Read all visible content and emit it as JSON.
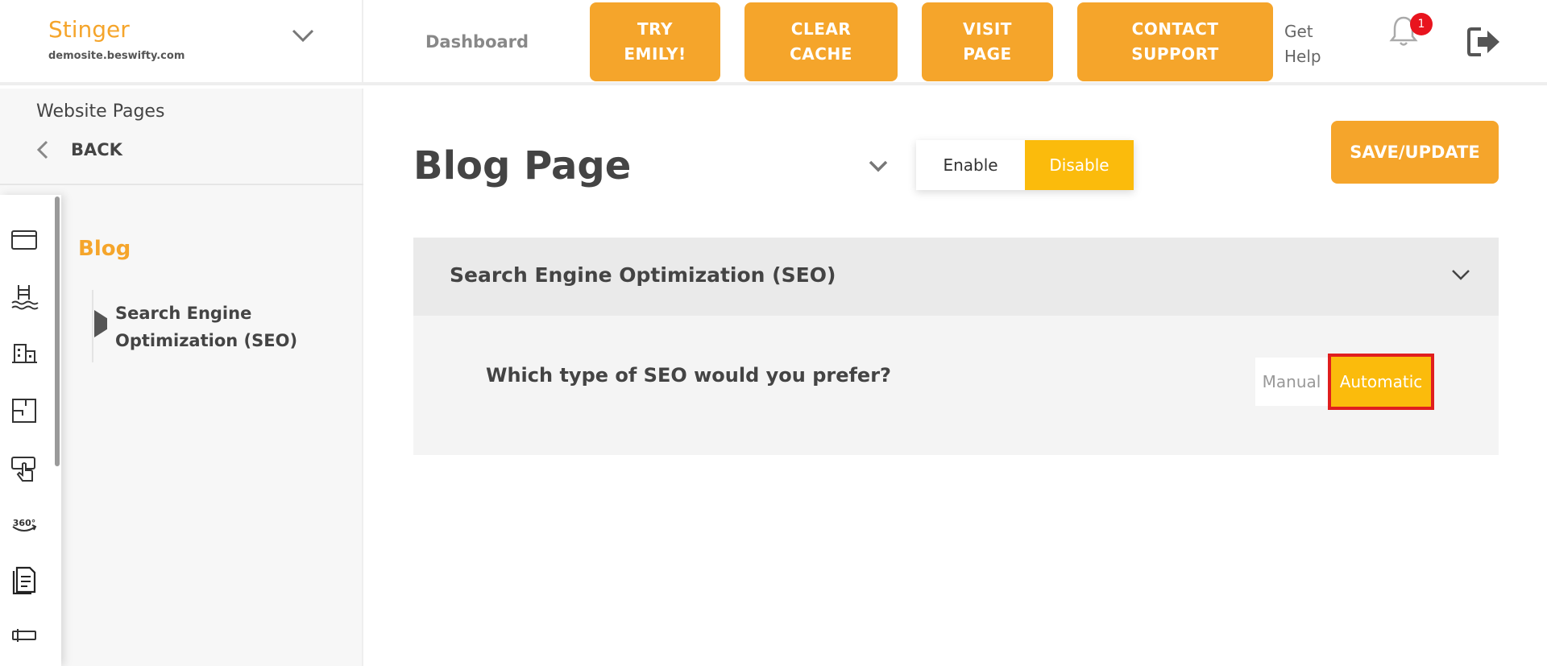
{
  "brand": {
    "name": "Stinger",
    "domain": "demosite.beswifty.com"
  },
  "header": {
    "dashboard": "Dashboard",
    "buttons": [
      {
        "line1": "TRY",
        "line2": "EMILY!"
      },
      {
        "line1": "CLEAR",
        "line2": "CACHE"
      },
      {
        "line1": "VISIT",
        "line2": "PAGE"
      },
      {
        "line1": "CONTACT",
        "line2": "SUPPORT"
      }
    ],
    "help": {
      "line1": "Get",
      "line2": "Help"
    },
    "notification_count": "1"
  },
  "sidebar": {
    "title": "Website Pages",
    "back_label": "BACK",
    "section": "Blog",
    "sub_item": "Search Engine Optimization (SEO)",
    "rail_icons": [
      "browser-window-icon",
      "pool-icon",
      "buildings-icon",
      "floor-plan-icon",
      "touch-screen-icon",
      "360-view-icon",
      "document-icon",
      "form-icon"
    ]
  },
  "main": {
    "title": "Blog Page",
    "toggle": {
      "enable": "Enable",
      "disable": "Disable",
      "active": "Disable"
    },
    "save_label": "SAVE/UPDATE",
    "seo": {
      "header": "Search Engine Optimization (SEO)",
      "question": "Which type of SEO would you prefer?",
      "manual": "Manual",
      "automatic": "Automatic",
      "selected": "Automatic"
    }
  },
  "colors": {
    "accent": "#f5a52b",
    "toggle_active": "#fbbb0c",
    "highlight": "#e01e1e",
    "badge": "#e8141e"
  }
}
